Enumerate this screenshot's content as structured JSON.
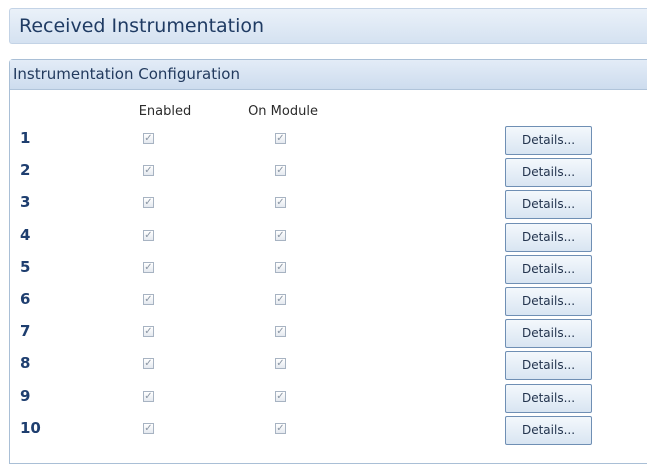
{
  "header": {
    "title": "Received Instrumentation"
  },
  "panel": {
    "title": "Instrumentation Configuration"
  },
  "columns": {
    "enabled": "Enabled",
    "on_module": "On Module"
  },
  "check_glyph": "✓",
  "details_label": "Details...",
  "rows": [
    {
      "num": "1",
      "enabled": true,
      "on_module": true
    },
    {
      "num": "2",
      "enabled": true,
      "on_module": true
    },
    {
      "num": "3",
      "enabled": true,
      "on_module": true
    },
    {
      "num": "4",
      "enabled": true,
      "on_module": true
    },
    {
      "num": "5",
      "enabled": true,
      "on_module": true
    },
    {
      "num": "6",
      "enabled": true,
      "on_module": true
    },
    {
      "num": "7",
      "enabled": true,
      "on_module": true
    },
    {
      "num": "8",
      "enabled": true,
      "on_module": true
    },
    {
      "num": "9",
      "enabled": true,
      "on_module": true
    },
    {
      "num": "10",
      "enabled": true,
      "on_module": true
    }
  ]
}
